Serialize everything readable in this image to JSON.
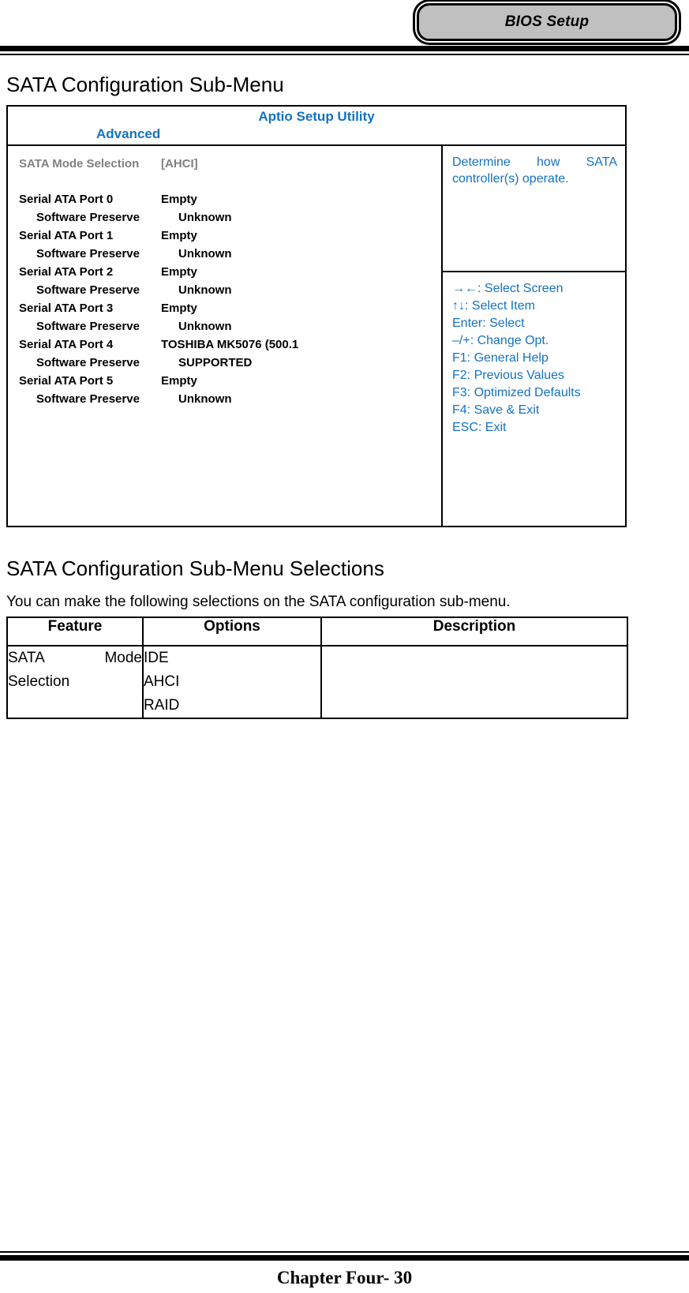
{
  "header": {
    "badge_label": "BIOS Setup"
  },
  "headings": {
    "section_one": "SATA Configuration Sub-Menu",
    "section_two": "SATA Configuration Sub-Menu Selections",
    "intro": "You can make the following selections on the SATA configuration sub-menu."
  },
  "bios_screen": {
    "title": "Aptio Setup Utility",
    "tab": "Advanced",
    "items": [
      {
        "label": "SATA Mode Selection",
        "value": "[AHCI]",
        "selected": true,
        "indent": false
      },
      {
        "label": "Serial ATA Port 0",
        "value": "Empty",
        "selected": false,
        "indent": false
      },
      {
        "label": "Software Preserve",
        "value": "Unknown",
        "selected": false,
        "indent": true
      },
      {
        "label": "Serial ATA Port 1",
        "value": "Empty",
        "selected": false,
        "indent": false
      },
      {
        "label": "Software Preserve",
        "value": "Unknown",
        "selected": false,
        "indent": true
      },
      {
        "label": "Serial ATA Port 2",
        "value": "Empty",
        "selected": false,
        "indent": false
      },
      {
        "label": "Software Preserve",
        "value": "Unknown",
        "selected": false,
        "indent": true
      },
      {
        "label": "Serial ATA Port 3",
        "value": "Empty",
        "selected": false,
        "indent": false
      },
      {
        "label": "Software Preserve",
        "value": "Unknown",
        "selected": false,
        "indent": true
      },
      {
        "label": "Serial ATA Port 4",
        "value": "TOSHIBA MK5076 (500.1",
        "selected": false,
        "indent": false
      },
      {
        "label": "Software Preserve",
        "value": "SUPPORTED",
        "selected": false,
        "indent": true
      },
      {
        "label": "Serial ATA Port 5",
        "value": "Empty",
        "selected": false,
        "indent": false
      },
      {
        "label": "Software Preserve",
        "value": "Unknown",
        "selected": false,
        "indent": true
      }
    ],
    "help_text": "Determine how SATA controller(s) operate.",
    "key_legend": [
      "→←: Select Screen",
      "↑↓: Select Item",
      "Enter: Select",
      "–/+: Change Opt.",
      "F1: General Help",
      "F2: Previous Values",
      "F3: Optimized Defaults",
      "F4: Save & Exit",
      "ESC: Exit"
    ],
    "accent_color": "#1472c4",
    "selected_color": "#808080"
  },
  "selections_table": {
    "columns": [
      "Feature",
      "Options",
      "Description"
    ],
    "rows": [
      {
        "feature": [
          "SATA Mode",
          "Selection"
        ],
        "options": [
          "IDE",
          "AHCI",
          "RAID"
        ],
        "description": ""
      }
    ]
  },
  "footer": {
    "text": "Chapter Four- 30"
  }
}
